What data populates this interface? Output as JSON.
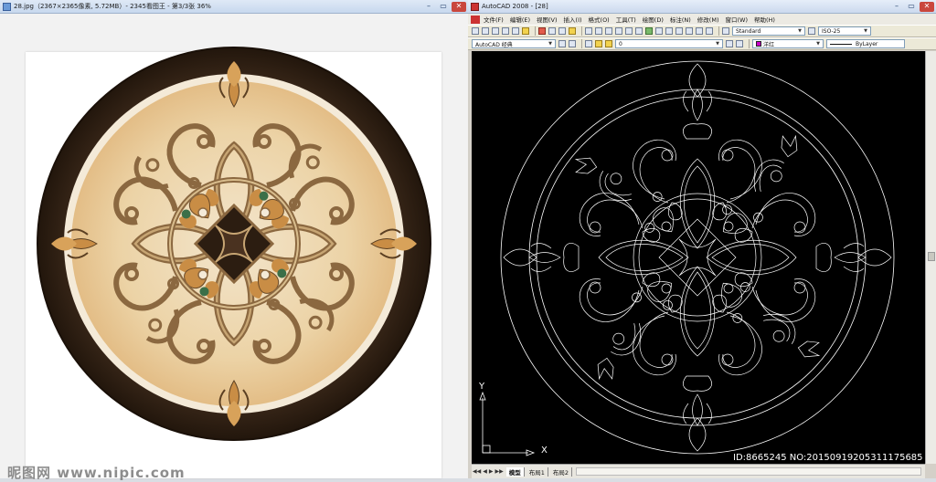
{
  "viewer": {
    "title": "28.jpg（2367×2365像素, 5.72MB）- 2345看图王 - 第3/3张 36%",
    "minimize": "–",
    "restore": "▭",
    "close": "✕",
    "watermark": "昵图网 www.nipic.com",
    "artwork": "marble-medallion-render"
  },
  "acad": {
    "title": "AutoCAD 2008 - [28]",
    "minimize": "–",
    "restore": "▭",
    "close": "✕",
    "menu": [
      "文件(F)",
      "编辑(E)",
      "视图(V)",
      "插入(I)",
      "格式(O)",
      "工具(T)",
      "绘图(D)",
      "标注(N)",
      "修改(M)",
      "窗口(W)",
      "帮助(H)"
    ],
    "text_style": "Standard",
    "dim_style": "ISO-25",
    "workspace": "AutoCAD 经典",
    "layer": "0",
    "color": "洋红",
    "linetype": "ByLayer",
    "ucs_y": "Y",
    "ucs_x": "X",
    "tabs": [
      "模型",
      "布局1",
      "布局2"
    ],
    "id_text": "ID:8665245 NO:20150919205311175685",
    "colors": {
      "canvas": "#000000",
      "lines": "#ffffff",
      "accent": "#c800c8"
    }
  }
}
